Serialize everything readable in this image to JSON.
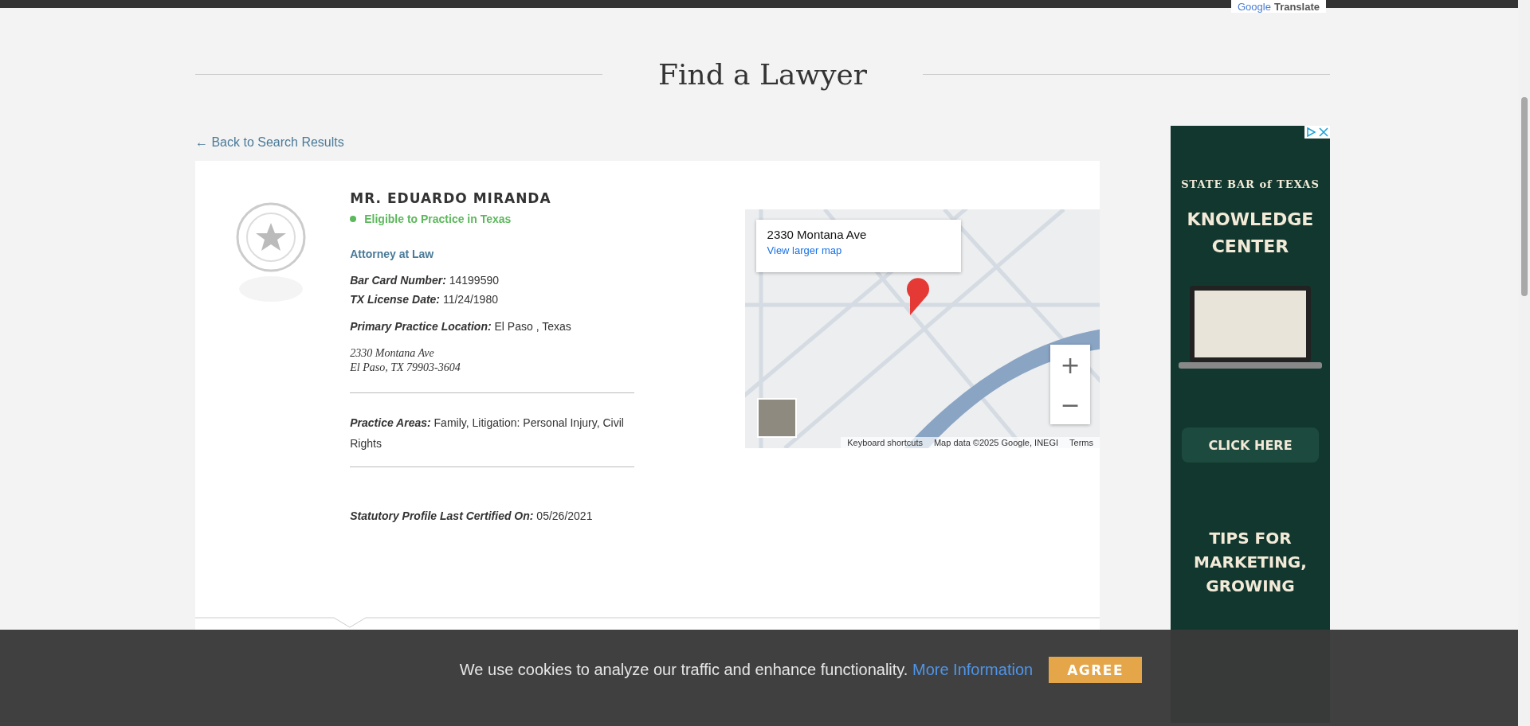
{
  "translate": {
    "brand": "Google",
    "label": "Translate"
  },
  "page_title": "Find a Lawyer",
  "back_link": "← Back to Search Results",
  "profile": {
    "name": "MR. EDUARDO MIRANDA",
    "status": {
      "label": "Eligible to Practice in Texas",
      "eligible": true
    },
    "occupation": "Attorney at Law",
    "groups": [
      {
        "fields": [
          {
            "label": "Bar Card Number:",
            "value": "14199590"
          },
          {
            "label": "TX License Date:",
            "value": "11/24/1980"
          }
        ]
      },
      {
        "fields": [
          {
            "label": "Primary Practice Location:",
            "value": "El Paso , Texas"
          }
        ]
      }
    ],
    "address": [
      "2330 Montana Ave",
      "El Paso, TX 79903-3604"
    ],
    "practice_areas": {
      "label": "Practice Areas:",
      "value": "Family, Litigation: Personal Injury, Civil Rights"
    },
    "certified": {
      "label": "Statutory Profile Last Certified On:",
      "value": "05/26/2021"
    }
  },
  "map": {
    "place": "2330 Montana Ave",
    "link": "View larger map",
    "zoom_in": "+",
    "zoom_out": "−",
    "footer": [
      "Keyboard shortcuts",
      "Map data ©2025 Google, INEGI",
      "Terms"
    ]
  },
  "ad": {
    "brand": "STATE BAR of TEXAS",
    "headline": "KNOWLEDGE CENTER",
    "button": "CLICK HERE",
    "tagline": "TIPS FOR MARKETING, GROWING"
  },
  "cookie_bar": {
    "message": "We use cookies to analyze our traffic and enhance functionality.",
    "link": "More Information",
    "button": "AGREE"
  }
}
